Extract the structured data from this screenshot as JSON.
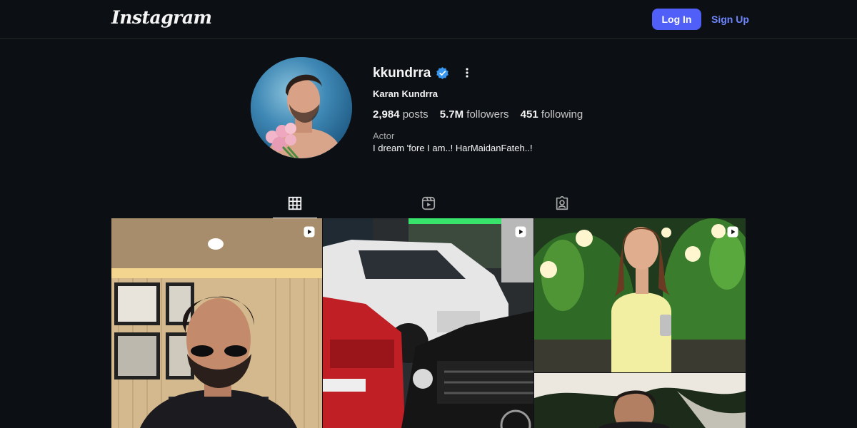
{
  "header": {
    "logo": "Instagram",
    "login_label": "Log In",
    "signup_label": "Sign Up"
  },
  "profile": {
    "username": "kkundrra",
    "full_name": "Karan Kundrra",
    "stats": [
      {
        "value": "2,984",
        "label": "posts"
      },
      {
        "value": "5.7M",
        "label": "followers"
      },
      {
        "value": "451",
        "label": "following"
      }
    ],
    "category": "Actor",
    "bio": "I dream 'fore I am..! HarMaidanFateh..!"
  },
  "tabs": [
    {
      "name": "posts",
      "icon": "grid-icon",
      "active": true
    },
    {
      "name": "reels",
      "icon": "reels-icon",
      "active": false
    },
    {
      "name": "tagged",
      "icon": "tagged-icon",
      "active": false
    }
  ],
  "posts": [
    {
      "type": "reel",
      "description_icon": "reel-icon"
    },
    {
      "type": "reel",
      "description_icon": "reel-icon"
    },
    {
      "type": "reel",
      "description_icon": "reel-icon"
    },
    {
      "type": "post"
    }
  ],
  "colors": {
    "background": "#0c1014",
    "accent": "#4f5ff7",
    "link": "#6f86ff",
    "verified": "#3897f0"
  }
}
